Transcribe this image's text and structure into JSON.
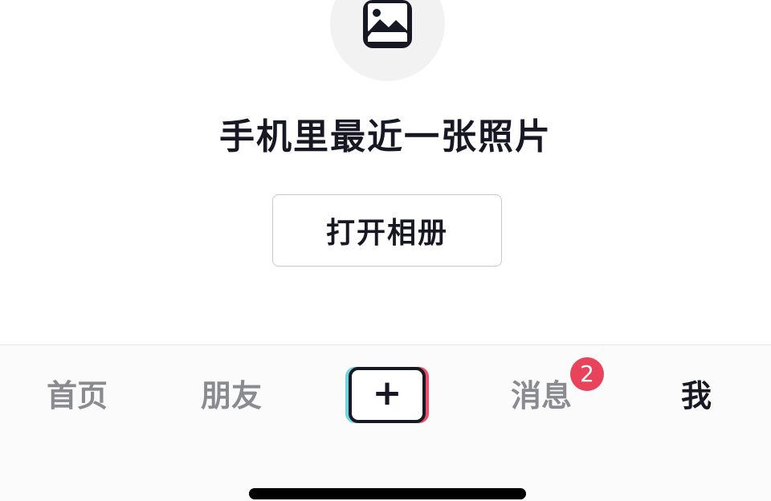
{
  "empty_state": {
    "icon": "image-icon",
    "title": "手机里最近一张照片",
    "open_album_label": "打开相册"
  },
  "tabbar": {
    "home_label": "首页",
    "friends_label": "朋友",
    "create_icon": "plus-icon",
    "messages_label": "消息",
    "messages_badge": "2",
    "me_label": "我",
    "active_tab": "我"
  },
  "colors": {
    "text_primary": "#161823",
    "text_inactive": "#8a8b91",
    "badge": "#e9435b",
    "create_cyan": "#6fd6e0",
    "create_pink": "#ec4f6b"
  }
}
